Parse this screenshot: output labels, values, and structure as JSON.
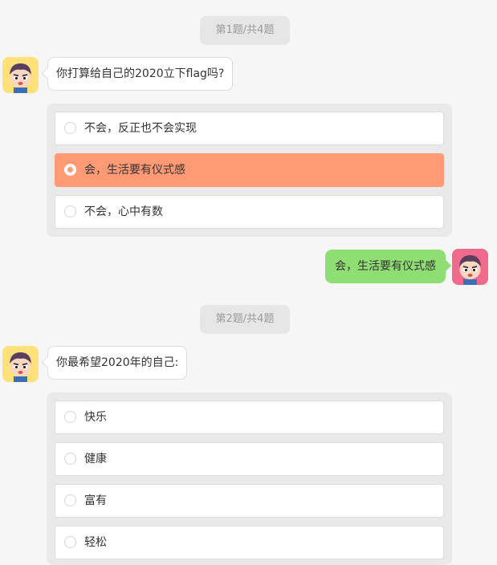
{
  "questions": [
    {
      "badge": "第1题/共4题",
      "prompt": "你打算给自己的2020立下flag吗?",
      "options": [
        {
          "label": "不会，反正也不会实现",
          "selected": false
        },
        {
          "label": "会，生活要有仪式感",
          "selected": true
        },
        {
          "label": "不会，心中有数",
          "selected": false
        }
      ],
      "answer": "会，生活要有仪式感"
    },
    {
      "badge": "第2题/共4题",
      "prompt": "你最希望2020年的自己:",
      "options": [
        {
          "label": "快乐",
          "selected": false
        },
        {
          "label": "健康",
          "selected": false
        },
        {
          "label": "富有",
          "selected": false
        },
        {
          "label": "轻松",
          "selected": false
        }
      ]
    }
  ],
  "colors": {
    "background": "#f6f6f6",
    "selected_option": "#ff9a74",
    "user_bubble": "#8fde73",
    "bot_avatar_bg": "#ffe07a",
    "user_avatar_bg": "#f06a8c"
  },
  "icons": {
    "bot_avatar": "cartoon-boy-avatar-icon",
    "user_avatar": "cartoon-boy-avatar-icon",
    "radio": "radio-circle-icon"
  }
}
